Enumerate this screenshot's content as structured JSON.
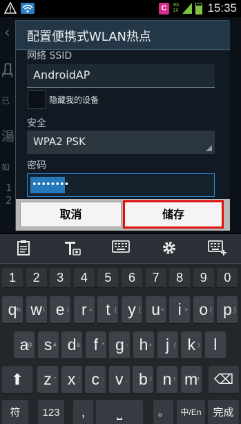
{
  "status_bar": {
    "carrier_badge": "C",
    "network_label": "3G",
    "network_sub": "1X",
    "time": "15:35",
    "accent_color": "#2a7fc3"
  },
  "dialog": {
    "title": "配置便携式WLAN热点",
    "ssid_label": "网络 SSID",
    "ssid_value": "AndroidAP",
    "hide_device_label": "隐藏我的设备",
    "security_label": "安全",
    "security_value": "WPA2 PSK",
    "password_label": "密码",
    "password_value": "••••••••",
    "cancel_label": "取消",
    "save_label": "储存"
  },
  "keyboard": {
    "toolbar_icons": [
      "clipboard-icon",
      "text-recognition-icon",
      "keyboard-icon",
      "gear-icon",
      "grid-keyboard-icon"
    ],
    "number_row": [
      "1",
      "2",
      "3",
      "4",
      "5",
      "6",
      "7",
      "8",
      "9",
      "0"
    ],
    "row1": [
      {
        "k": "q",
        "h": "%"
      },
      {
        "k": "w",
        "h": "\\"
      },
      {
        "k": "e",
        "h": "|"
      },
      {
        "k": "r",
        "h": "="
      },
      {
        "k": "t",
        "h": "["
      },
      {
        "k": "y",
        "h": "]"
      },
      {
        "k": "u",
        "h": "<"
      },
      {
        "k": "i",
        "h": ">"
      },
      {
        "k": "o",
        "h": "{"
      },
      {
        "k": "p",
        "h": "}"
      }
    ],
    "row2": [
      {
        "k": "a",
        "h": "@"
      },
      {
        "k": "s",
        "h": "#"
      },
      {
        "k": "d",
        "h": "&"
      },
      {
        "k": "f",
        "h": "*"
      },
      {
        "k": "g",
        "h": "-"
      },
      {
        "k": "h",
        "h": "+"
      },
      {
        "k": "j",
        "h": "("
      },
      {
        "k": "k",
        "h": ")"
      },
      {
        "k": "l",
        "h": ""
      }
    ],
    "row3": [
      {
        "k": "z",
        "h": "\""
      },
      {
        "k": "x",
        "h": "'"
      },
      {
        "k": "c",
        "h": ":"
      },
      {
        "k": "v",
        "h": ";"
      },
      {
        "k": "b",
        "h": "/"
      },
      {
        "k": "n",
        "h": "!"
      },
      {
        "k": "m",
        "h": "?"
      }
    ],
    "shift_symbol": "⬆",
    "backspace_symbol": "⌫",
    "bottom_row": {
      "sym": "符",
      "num": "123",
      "comma": ",",
      "space": "⎵",
      "period": "。",
      "lang": "中/En",
      "done": "完成"
    }
  },
  "background": {
    "partial_texts": [
      "已",
      "湯",
      "如",
      "1",
      "2"
    ]
  }
}
